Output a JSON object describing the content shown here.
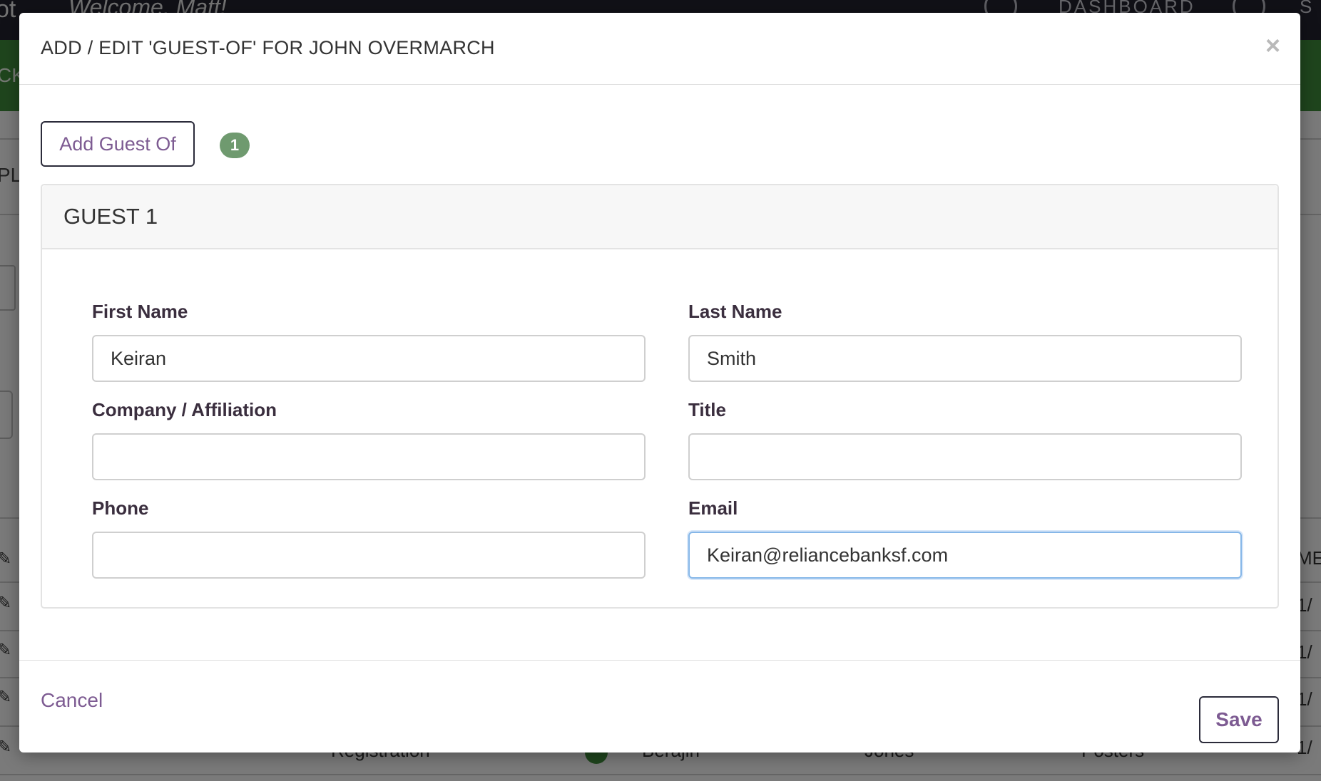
{
  "background": {
    "brand": "ot",
    "welcome": "Welcome, Matt!",
    "nav_dashboard": "DASHBOARD",
    "nav_right": "S",
    "green_bar_text": "CK",
    "side_text": "PL",
    "right_header": "ME",
    "row_dates": [
      "1/",
      "1/",
      "1/",
      "1/"
    ],
    "partial_row": {
      "col1": "Registration",
      "col2": "Berajin",
      "col3": "Jones",
      "col4": "Posters"
    }
  },
  "modal": {
    "title": "ADD / EDIT 'GUEST-OF' FOR JOHN OVERMARCH",
    "close_glyph": "×",
    "add_button": "Add Guest Of",
    "guest_count": "1",
    "guest_card": {
      "title": "GUEST 1",
      "fields": {
        "first_name": {
          "label": "First Name",
          "value": "Keiran",
          "placeholder": ""
        },
        "last_name": {
          "label": "Last Name",
          "value": "Smith",
          "placeholder": ""
        },
        "company": {
          "label": "Company / Affiliation",
          "value": "",
          "placeholder": ""
        },
        "title": {
          "label": "Title",
          "value": "",
          "placeholder": ""
        },
        "phone": {
          "label": "Phone",
          "value": "",
          "placeholder": ""
        },
        "email": {
          "label": "Email",
          "value": "Keiran@reliancebanksf.com",
          "placeholder": ""
        }
      }
    },
    "footer": {
      "cancel": "Cancel",
      "save": "Save"
    }
  },
  "colors": {
    "accent_purple": "#7d5b92",
    "badge_green": "#6f9a6f",
    "top_bar": "#23232f",
    "green_bar": "#3f8a3a",
    "focus_blue": "#86b7e8"
  },
  "icons": {
    "close": "close-icon",
    "user": "user-icon",
    "settings": "gear-icon",
    "edit": "pencil-icon"
  }
}
